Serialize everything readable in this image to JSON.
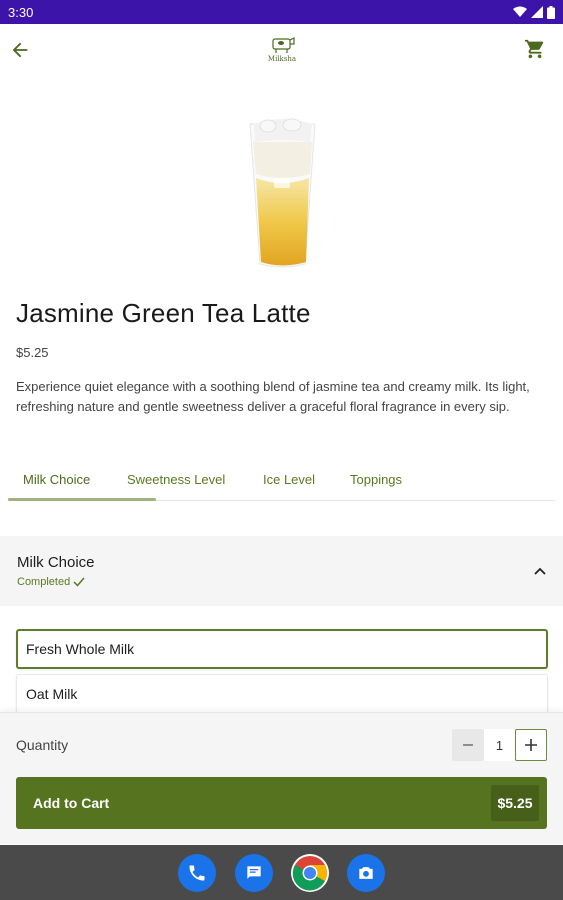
{
  "status_bar": {
    "time": "3:30"
  },
  "app_bar": {
    "logo_text": "Milksha"
  },
  "product": {
    "title": "Jasmine Green Tea Latte",
    "price": "$5.25",
    "description": "Experience quiet elegance with a soothing blend of jasmine tea and creamy milk. Its light, refreshing nature and gentle sweetness deliver a graceful floral fragrance in every sip."
  },
  "tabs": [
    {
      "label": "Milk Choice",
      "active": true
    },
    {
      "label": "Sweetness Level",
      "active": false
    },
    {
      "label": "Ice Level",
      "active": false
    },
    {
      "label": "Toppings",
      "active": false
    }
  ],
  "section": {
    "title": "Milk Choice",
    "status": "Completed"
  },
  "options": [
    {
      "label": "Fresh Whole Milk",
      "selected": true
    },
    {
      "label": "Oat Milk",
      "selected": false
    }
  ],
  "quantity": {
    "label": "Quantity",
    "value": "1"
  },
  "add_to_cart": {
    "label": "Add to Cart",
    "price": "$5.25"
  },
  "dock": [
    "phone-icon",
    "messages-icon",
    "chrome-icon",
    "camera-icon"
  ],
  "colors": {
    "status_bar": "#3d14a9",
    "accent_green": "#56731f",
    "nav_bar": "#4a4a4a"
  }
}
